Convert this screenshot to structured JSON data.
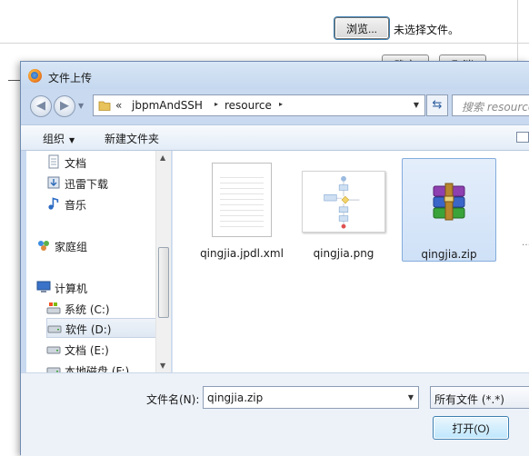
{
  "page": {
    "browse_label": "浏览...",
    "no_file_label": "未选择文件。",
    "ok_label": "确定",
    "cancel_label": "取消"
  },
  "dialog": {
    "title": "文件上传",
    "address": {
      "overflow": "«",
      "crumbs": [
        "jbpmAndSSH",
        "resource"
      ],
      "arrow": "▸"
    },
    "search_placeholder": "搜索 resource",
    "toolbar": {
      "organize_label": "组织",
      "new_folder_label": "新建文件夹"
    },
    "nav_items": [
      {
        "label": "文档",
        "icon": "documents-icon"
      },
      {
        "label": "迅雷下载",
        "icon": "download-folder-icon"
      },
      {
        "label": "音乐",
        "icon": "music-icon"
      },
      {
        "label": "家庭组",
        "icon": "homegroup-icon"
      },
      {
        "label": "计算机",
        "icon": "computer-icon"
      },
      {
        "label": "系统 (C:)",
        "icon": "system-drive-icon"
      },
      {
        "label": "软件 (D:)",
        "icon": "drive-icon"
      },
      {
        "label": "文档 (E:)",
        "icon": "drive-icon"
      },
      {
        "label": "本地磁盘 (F:)",
        "icon": "drive-icon"
      }
    ],
    "files": [
      {
        "name": "qingjia.jpdl.xml",
        "icon": "xml-file-icon"
      },
      {
        "name": "qingjia.png",
        "icon": "image-thumbnail"
      },
      {
        "name": "qingjia.zip",
        "icon": "winrar-archive-icon"
      }
    ],
    "filename_label": "文件名(N):",
    "filename_value": "qingjia.zip",
    "filetype_value": "所有文件 (*.*)",
    "open_label": "打开(O)"
  },
  "colors": {
    "dialog_frame": "#c9daf0",
    "selection": "#cfe1f7",
    "selection_border": "#84acdd"
  }
}
